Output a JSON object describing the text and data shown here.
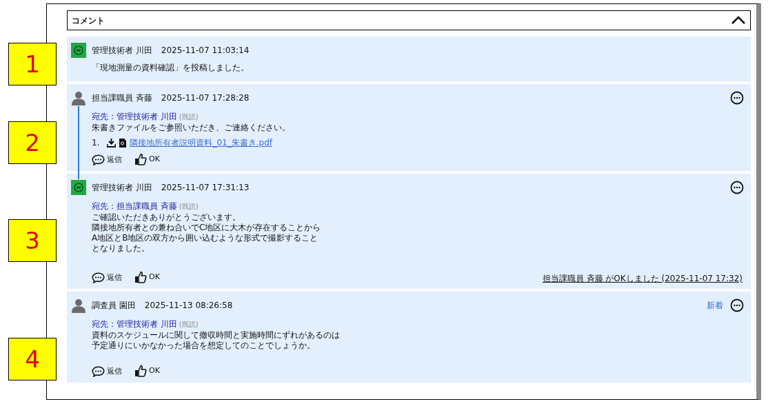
{
  "panel": {
    "title": "コメント",
    "expanded": true
  },
  "comments": [
    {
      "avatar": {
        "kind": "badge"
      },
      "author": "管理技術者 川田",
      "time": "2025-11-07 11:03:14",
      "body_lines": [
        "「現地測量の資料確認」を投稿しました。"
      ],
      "menu": false,
      "thread_line": false
    },
    {
      "avatar": {
        "kind": "person"
      },
      "author": "担当課職員 斉藤",
      "time": "2025-11-07 17:28:28",
      "to": "宛先：管理技術者 川田",
      "read": "(既読)",
      "body_lines": [
        "朱書きファイルをご参照いただき、ご連絡ください。"
      ],
      "attachments": [
        {
          "index": "1.",
          "file": "隣接地所有者説明資料_01_朱書き.pdf"
        }
      ],
      "actions": [
        "返信",
        "OK"
      ],
      "menu": true,
      "thread_line": true
    },
    {
      "avatar": {
        "kind": "badge"
      },
      "author": "管理技術者 川田",
      "time": "2025-11-07 17:31:13",
      "to": "宛先：担当課職員 斉藤",
      "read": "(既読)",
      "body_lines": [
        "ご確認いただきありがとうございます。",
        "隣接地所有者との兼ね合いでC地区に大木が存在することから",
        "A地区とB地区の双方から囲い込むような形式で撮影すること",
        "となりました。"
      ],
      "actions": [
        "返信",
        "OK"
      ],
      "ok_note": "担当課職員 斉藤 がOKしました (2025-11-07 17:32)",
      "menu": true,
      "thread_line": false
    },
    {
      "avatar": {
        "kind": "person"
      },
      "author": "調査員 園田",
      "time": "2025-11-13 08:26:58",
      "to": "宛先：管理技術者 川田",
      "read": "(既読)",
      "body_lines": [
        "資料のスケジュールに関して撤収時間と実施時間にずれがあるのは",
        "予定通りにいかなかった場合を想定してのことでしょうか。"
      ],
      "actions": [
        "返信",
        "OK"
      ],
      "new_label": "新着",
      "menu": true,
      "thread_line": false
    }
  ],
  "callouts": [
    "1",
    "2",
    "3",
    "4"
  ]
}
